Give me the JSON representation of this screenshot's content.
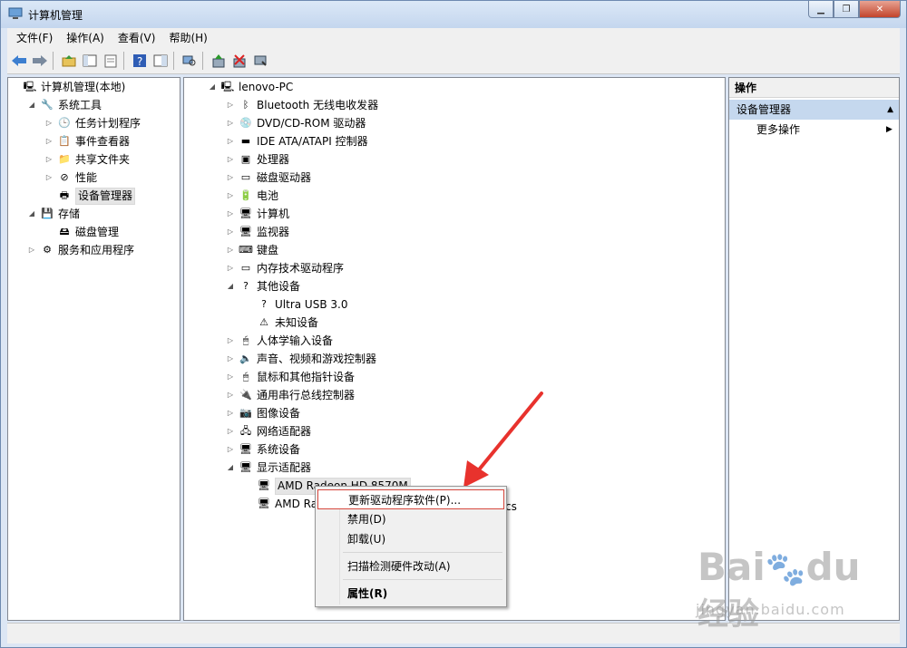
{
  "window": {
    "title": "计算机管理"
  },
  "menubar": [
    "文件(F)",
    "操作(A)",
    "查看(V)",
    "帮助(H)"
  ],
  "toolbar": [
    "back-arrow-icon",
    "forward-arrow-icon",
    "up-folder-icon",
    "show-tree-icon",
    "properties-icon",
    "help-icon",
    "console-tree-icon",
    "scan-icon",
    "update-driver-icon",
    "uninstall-icon",
    "disable-icon"
  ],
  "left_tree": [
    {
      "label": "计算机管理(本地)",
      "depth": 0,
      "exp": "",
      "icon": "🖳"
    },
    {
      "label": "系统工具",
      "depth": 1,
      "exp": "◢",
      "icon": "🔧"
    },
    {
      "label": "任务计划程序",
      "depth": 2,
      "exp": "▷",
      "icon": "🕒"
    },
    {
      "label": "事件查看器",
      "depth": 2,
      "exp": "▷",
      "icon": "📋"
    },
    {
      "label": "共享文件夹",
      "depth": 2,
      "exp": "▷",
      "icon": "📁"
    },
    {
      "label": "性能",
      "depth": 2,
      "exp": "▷",
      "icon": "⊘"
    },
    {
      "label": "设备管理器",
      "depth": 2,
      "exp": "",
      "icon": "🖶",
      "selected": true
    },
    {
      "label": "存储",
      "depth": 1,
      "exp": "◢",
      "icon": "💾"
    },
    {
      "label": "磁盘管理",
      "depth": 2,
      "exp": "",
      "icon": "🖴"
    },
    {
      "label": "服务和应用程序",
      "depth": 1,
      "exp": "▷",
      "icon": "⚙"
    }
  ],
  "device_tree": [
    {
      "label": "lenovo-PC",
      "depth": 0,
      "exp": "◢",
      "icon": "🖳"
    },
    {
      "label": "Bluetooth 无线电收发器",
      "depth": 1,
      "exp": "▷",
      "icon": "ᛒ"
    },
    {
      "label": "DVD/CD-ROM 驱动器",
      "depth": 1,
      "exp": "▷",
      "icon": "💿"
    },
    {
      "label": "IDE ATA/ATAPI 控制器",
      "depth": 1,
      "exp": "▷",
      "icon": "▬"
    },
    {
      "label": "处理器",
      "depth": 1,
      "exp": "▷",
      "icon": "▣"
    },
    {
      "label": "磁盘驱动器",
      "depth": 1,
      "exp": "▷",
      "icon": "▭"
    },
    {
      "label": "电池",
      "depth": 1,
      "exp": "▷",
      "icon": "🔋"
    },
    {
      "label": "计算机",
      "depth": 1,
      "exp": "▷",
      "icon": "🖥"
    },
    {
      "label": "监视器",
      "depth": 1,
      "exp": "▷",
      "icon": "🖥"
    },
    {
      "label": "键盘",
      "depth": 1,
      "exp": "▷",
      "icon": "⌨"
    },
    {
      "label": "内存技术驱动程序",
      "depth": 1,
      "exp": "▷",
      "icon": "▭"
    },
    {
      "label": "其他设备",
      "depth": 1,
      "exp": "◢",
      "icon": "?"
    },
    {
      "label": "Ultra USB 3.0",
      "depth": 2,
      "exp": "",
      "icon": "?"
    },
    {
      "label": "未知设备",
      "depth": 2,
      "exp": "",
      "icon": "⚠"
    },
    {
      "label": "人体学输入设备",
      "depth": 1,
      "exp": "▷",
      "icon": "🖱"
    },
    {
      "label": "声音、视频和游戏控制器",
      "depth": 1,
      "exp": "▷",
      "icon": "🔈"
    },
    {
      "label": "鼠标和其他指针设备",
      "depth": 1,
      "exp": "▷",
      "icon": "🖱"
    },
    {
      "label": "通用串行总线控制器",
      "depth": 1,
      "exp": "▷",
      "icon": "🔌"
    },
    {
      "label": "图像设备",
      "depth": 1,
      "exp": "▷",
      "icon": "📷"
    },
    {
      "label": "网络适配器",
      "depth": 1,
      "exp": "▷",
      "icon": "🖧"
    },
    {
      "label": "系统设备",
      "depth": 1,
      "exp": "▷",
      "icon": "🖥"
    },
    {
      "label": "显示适配器",
      "depth": 1,
      "exp": "◢",
      "icon": "🖥"
    },
    {
      "label": "AMD Radeon HD 8570M",
      "depth": 2,
      "exp": "",
      "icon": "🖥",
      "selected": true
    },
    {
      "label": "AMD Rade",
      "depth": 2,
      "exp": "",
      "icon": "🖥"
    }
  ],
  "device_tree_partial_suffix": "cs",
  "actions": {
    "header": "操作",
    "section": "设备管理器",
    "more": "更多操作"
  },
  "context_menu": [
    {
      "label": "更新驱动程序软件(P)...",
      "highlighted": true
    },
    {
      "label": "禁用(D)"
    },
    {
      "label": "卸载(U)"
    },
    {
      "separator": true
    },
    {
      "label": "扫描检测硬件改动(A)"
    },
    {
      "separator": true
    },
    {
      "label": "属性(R)",
      "bold": true
    }
  ],
  "annotation": {
    "arrow_color": "#e8322d"
  },
  "watermark": {
    "brand": "Bai",
    "brand_suffix": "du",
    "text": "经验",
    "url": "jingyan.baidu.com"
  }
}
